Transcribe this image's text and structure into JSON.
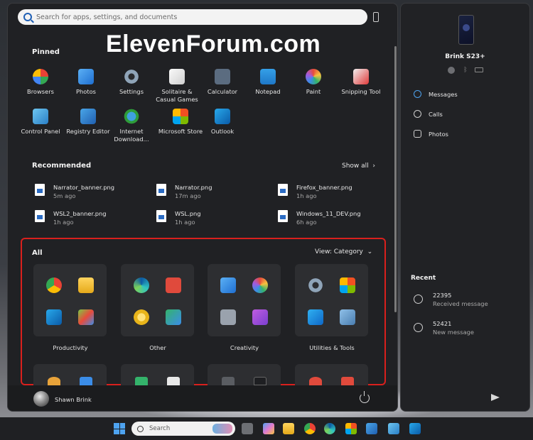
{
  "search": {
    "placeholder": "Search for apps, settings, and documents"
  },
  "watermark": "ElevenForum.com",
  "pinned": {
    "title": "Pinned",
    "apps": [
      {
        "label": "Browsers",
        "icon": "browsers-icon"
      },
      {
        "label": "Photos",
        "icon": "photos-icon"
      },
      {
        "label": "Settings",
        "icon": "settings-icon"
      },
      {
        "label": "Solitaire & Casual Games",
        "line1": "Solitaire &",
        "line2": "Casual Games",
        "icon": "solitaire-icon"
      },
      {
        "label": "Calculator",
        "icon": "calculator-icon"
      },
      {
        "label": "Notepad",
        "icon": "notepad-icon"
      },
      {
        "label": "Paint",
        "icon": "paint-icon"
      },
      {
        "label": "Snipping Tool",
        "icon": "snipping-tool-icon"
      },
      {
        "label": "Control Panel",
        "icon": "control-panel-icon"
      },
      {
        "label": "Registry Editor",
        "icon": "registry-editor-icon"
      },
      {
        "label": "Internet Download...",
        "line1": "Internet",
        "line2": "Download...",
        "icon": "internet-download-icon"
      },
      {
        "label": "Microsoft Store",
        "icon": "microsoft-store-icon"
      },
      {
        "label": "Outlook",
        "icon": "outlook-icon"
      }
    ]
  },
  "recommended": {
    "title": "Recommended",
    "show_all": "Show all",
    "items": [
      {
        "name": "Narrator_banner.png",
        "time": "5m ago"
      },
      {
        "name": "Narrator.png",
        "time": "17m ago"
      },
      {
        "name": "Firefox_banner.png",
        "time": "1h ago"
      },
      {
        "name": "WSL2_banner.png",
        "time": "1h ago"
      },
      {
        "name": "WSL.png",
        "time": "1h ago"
      },
      {
        "name": "Windows_11_DEV.png",
        "time": "6h ago"
      }
    ]
  },
  "all": {
    "title": "All",
    "view": "View: Category",
    "categories": [
      {
        "label": "Productivity"
      },
      {
        "label": "Other"
      },
      {
        "label": "Creativity"
      },
      {
        "label": "Utilities & Tools"
      }
    ]
  },
  "user": {
    "name": "Shawn Brink"
  },
  "phone": {
    "device_name": "Brink S23+",
    "nav": [
      "Messages",
      "Calls",
      "Photos"
    ],
    "recent_title": "Recent",
    "messages": [
      {
        "number": "22395",
        "text": "Received message"
      },
      {
        "number": "52421",
        "text": "New message"
      }
    ]
  },
  "taskbar": {
    "search_label": "Search"
  },
  "colors": {
    "highlight": "#d9201d",
    "panel": "#202124",
    "accent": "#4ea3f0"
  }
}
